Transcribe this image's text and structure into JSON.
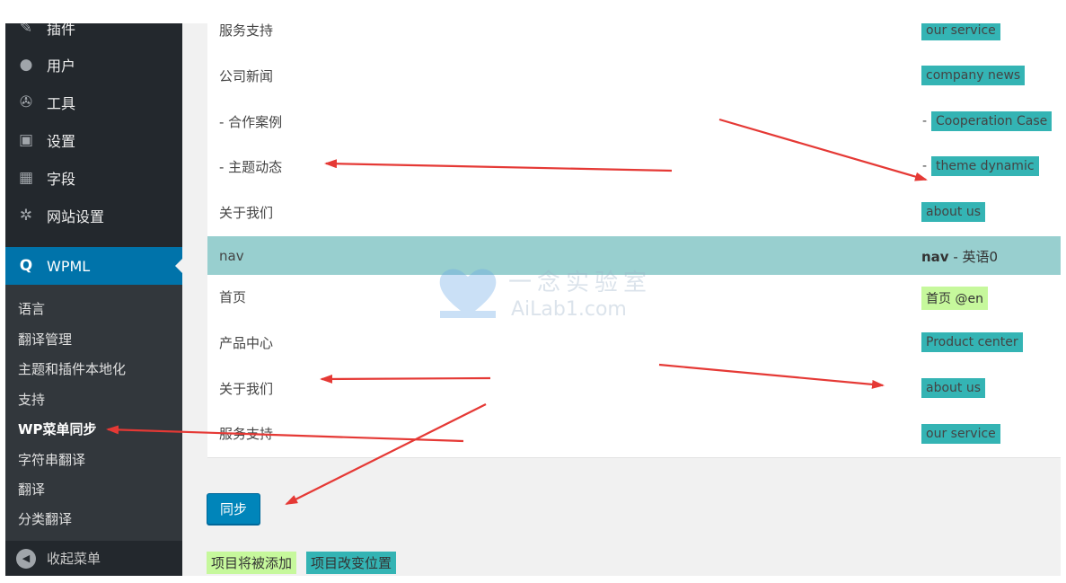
{
  "sidebar": {
    "items": [
      {
        "label": "插件",
        "icon": "plugin-icon"
      },
      {
        "label": "用户",
        "icon": "user-icon"
      },
      {
        "label": "工具",
        "icon": "wrench-icon"
      },
      {
        "label": "设置",
        "icon": "settings-icon"
      },
      {
        "label": "字段",
        "icon": "fields-icon"
      },
      {
        "label": "网站设置",
        "icon": "gear-icon"
      }
    ],
    "wpml": {
      "label": "WPML",
      "icon": "wpml-icon"
    },
    "submenu": [
      "语言",
      "翻译管理",
      "主题和插件本地化",
      "支持",
      "WP菜单同步",
      "字符串翻译",
      "翻译",
      "分类翻译"
    ],
    "collapse": "收起菜单"
  },
  "table": {
    "top_rows": [
      {
        "left": "服务支持",
        "right": "our service",
        "prefix": ""
      },
      {
        "left": "公司新闻",
        "right": "company news",
        "prefix": ""
      },
      {
        "left": "- 合作案例",
        "right": "Cooperation Case",
        "prefix": "-"
      },
      {
        "left": "- 主题动态",
        "right": "theme dynamic",
        "prefix": "-"
      },
      {
        "left": "关于我们",
        "right": "about us",
        "prefix": ""
      }
    ],
    "nav_row": {
      "left": "nav",
      "right_bold": "nav",
      "right_rest": " - 英语0"
    },
    "bottom_rows": [
      {
        "left": "首页",
        "right": "首页 @en"
      },
      {
        "left": "产品中心",
        "right": "Product center"
      },
      {
        "left": "关于我们",
        "right": "about us"
      },
      {
        "left": "服务支持",
        "right": "our service"
      }
    ]
  },
  "sync_button": "同步",
  "legend": {
    "added": "项目将被添加",
    "moved": "项目改变位置"
  },
  "watermark": {
    "line1": "一念实验室",
    "line2": "AiLab1.com"
  },
  "colors": {
    "sidebar": "#23282d",
    "wpml_active": "#0073aa",
    "teal": "#34b4b4",
    "green": "#c6f89c",
    "nav_row": "#98cfcf",
    "arrow": "#e53935"
  }
}
